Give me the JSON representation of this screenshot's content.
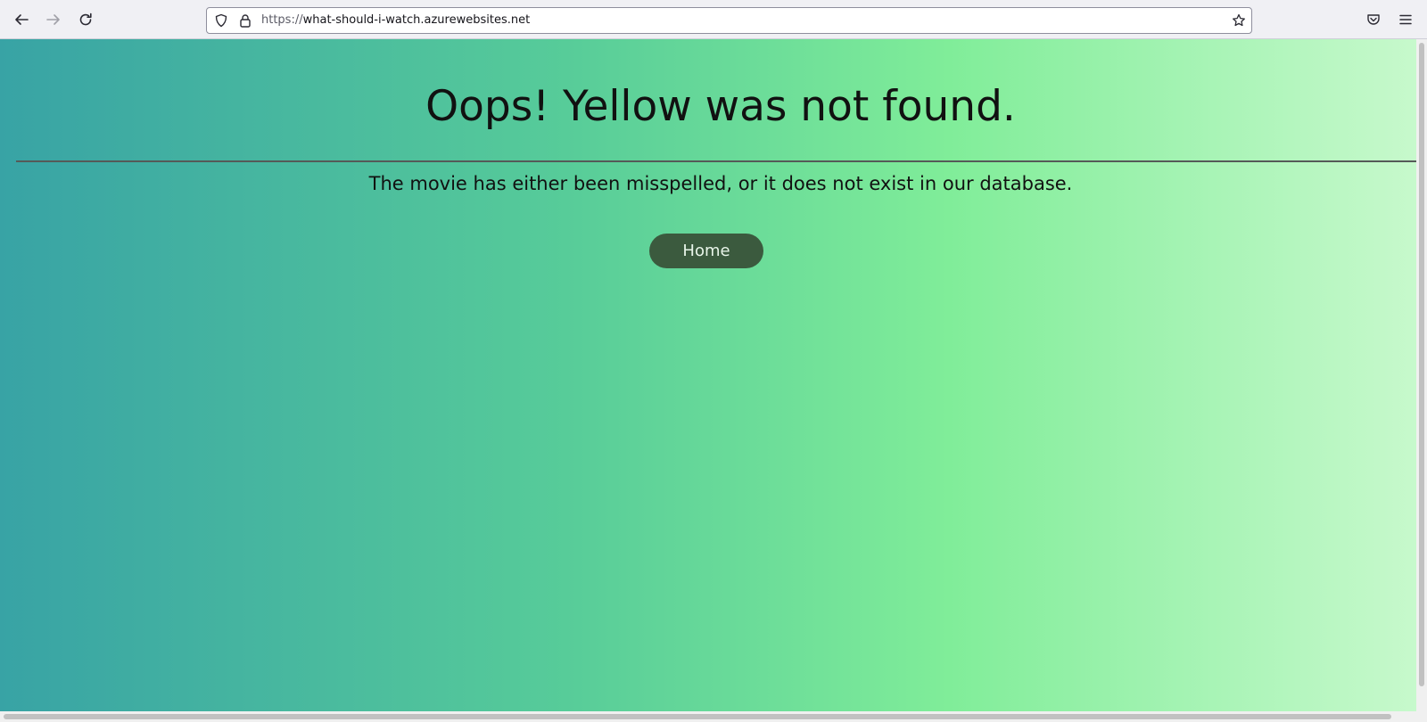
{
  "browser": {
    "url_scheme": "https://",
    "url_host": "what-should-i-watch.azurewebsites.net"
  },
  "page": {
    "title": "Oops! Yellow was not found.",
    "message": "The movie has either been misspelled, or it does not exist in our database.",
    "home_button_label": "Home"
  },
  "colors": {
    "gradient": [
      "#38a3a5",
      "#57cc99",
      "#80ed99",
      "#c7f9cc"
    ],
    "button_bg": "#3b5a3e",
    "text": "#111111"
  },
  "icons": [
    "back-arrow-icon",
    "forward-arrow-icon",
    "reload-icon",
    "shield-icon",
    "lock-icon",
    "star-icon",
    "pocket-icon",
    "menu-icon"
  ]
}
